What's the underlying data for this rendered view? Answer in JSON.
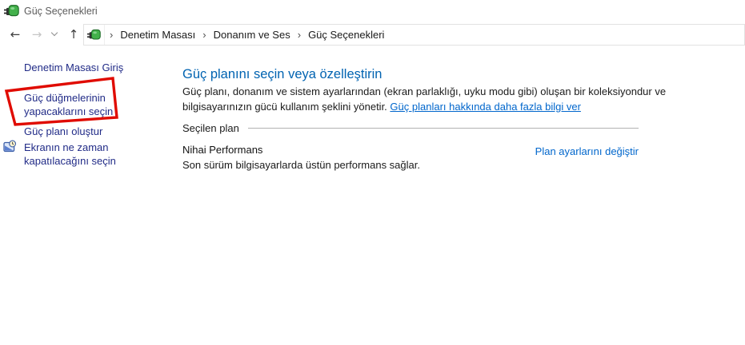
{
  "window": {
    "title": "Güç Seçenekleri"
  },
  "nav": {
    "back_icon": "←",
    "forward_icon": "→",
    "up_icon": "↑"
  },
  "breadcrumb": {
    "separator": "›",
    "items": [
      "Denetim Masası",
      "Donanım ve Ses",
      "Güç Seçenekleri"
    ]
  },
  "sidebar": {
    "items": [
      {
        "label": "Denetim Masası Giriş"
      },
      {
        "label": "Güç düğmelerinin yapacaklarını seçin",
        "annotated": true
      },
      {
        "label": "Güç planı oluştur"
      },
      {
        "label": "Ekranın ne zaman kapatılacağını seçin",
        "icon": "display-clock-icon"
      }
    ]
  },
  "main": {
    "heading": "Güç planını seçin veya özelleştirin",
    "intro_text": "Güç planı, donanım ve sistem ayarlarından (ekran parlaklığı, uyku modu gibi) oluşan bir koleksiyondur ve bilgisayarınızın gücü kullanım şeklini yönetir.",
    "intro_link": "Güç planları hakkında daha fazla bilgi ver",
    "section_label": "Seçilen plan",
    "selected_plan": {
      "name": "Nihai Performans",
      "description": "Son sürüm bilgisayarlarda üstün performans sağlar.",
      "settings_link": "Plan ayarlarını değiştir"
    }
  },
  "annotation": {
    "shape": "hand-drawn-red-rectangle",
    "target": "Güç düğmelerinin yapacaklarını seçin"
  },
  "colors": {
    "heading_blue": "#0063b1",
    "link_blue": "#0066cc",
    "sidebar_link_blue": "#212b87",
    "annotation_red": "#e00b00",
    "title_gray": "#5c5c5c"
  }
}
